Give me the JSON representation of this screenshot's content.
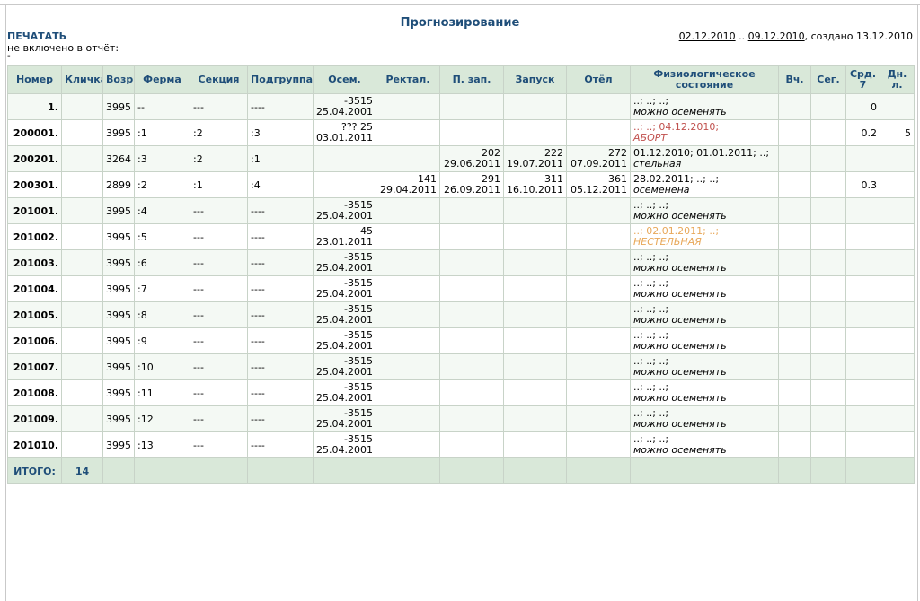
{
  "page": {
    "title": "Прогнозирование",
    "print_label": "ПЕЧАТАТЬ",
    "not_included": "не включено в отчёт:",
    "dash": "-",
    "date_from": "02.12.2010",
    "range_sep": " .. ",
    "date_to": "09.12.2010",
    "created": ", создано 13.12.2010"
  },
  "table": {
    "headers": [
      "Номер",
      "Кличка",
      "Возр.",
      "Ферма",
      "Секция",
      "Подгруппа",
      "Осем.",
      "Ректал.",
      "П. зап.",
      "Запуск",
      "Отёл",
      "Физиологическое состояние",
      "Вч.",
      "Сег.",
      "Срд. 7",
      "Дн. л."
    ],
    "rows": [
      {
        "num": "1.",
        "name": "",
        "age": "3995",
        "farm": "--",
        "section": "---",
        "subgroup": "----",
        "osem": [
          "-3515",
          "25.04.2001"
        ],
        "rekt": [
          "",
          ""
        ],
        "pzap": [
          "",
          ""
        ],
        "zapusk": [
          "",
          ""
        ],
        "otel": [
          "",
          ""
        ],
        "state": [
          "..; ..; ..;",
          "можно осеменять"
        ],
        "state_color": "",
        "vch": "",
        "seg": "",
        "srd": "0",
        "dnl": ""
      },
      {
        "num": "200001.",
        "name": "",
        "age": "3995",
        "farm": ":1",
        "section": ":2",
        "subgroup": ":3",
        "osem": [
          "??? 25",
          "03.01.2011"
        ],
        "rekt": [
          "",
          ""
        ],
        "pzap": [
          "",
          ""
        ],
        "zapusk": [
          "",
          ""
        ],
        "otel": [
          "",
          ""
        ],
        "state": [
          "..; ..; 04.12.2010;",
          "АБОРТ"
        ],
        "state_color": "red",
        "vch": "",
        "seg": "",
        "srd": "0.2",
        "dnl": "5"
      },
      {
        "num": "200201.",
        "name": "",
        "age": "3264",
        "farm": ":3",
        "section": ":2",
        "subgroup": ":1",
        "osem": [
          "",
          ""
        ],
        "rekt": [
          "",
          ""
        ],
        "pzap": [
          "202",
          "29.06.2011"
        ],
        "zapusk": [
          "222",
          "19.07.2011"
        ],
        "otel": [
          "272",
          "07.09.2011"
        ],
        "state": [
          "01.12.2010; 01.01.2011; ..;",
          "стельная"
        ],
        "state_color": "",
        "vch": "",
        "seg": "",
        "srd": "",
        "dnl": ""
      },
      {
        "num": "200301.",
        "name": "",
        "age": "2899",
        "farm": ":2",
        "section": ":1",
        "subgroup": ":4",
        "osem": [
          "",
          ""
        ],
        "rekt": [
          "141",
          "29.04.2011"
        ],
        "pzap": [
          "291",
          "26.09.2011"
        ],
        "zapusk": [
          "311",
          "16.10.2011"
        ],
        "otel": [
          "361",
          "05.12.2011"
        ],
        "state": [
          "28.02.2011; ..; ..;",
          "осеменена"
        ],
        "state_color": "",
        "vch": "",
        "seg": "",
        "srd": "0.3",
        "dnl": ""
      },
      {
        "num": "201001.",
        "name": "",
        "age": "3995",
        "farm": ":4",
        "section": "---",
        "subgroup": "----",
        "osem": [
          "-3515",
          "25.04.2001"
        ],
        "rekt": [
          "",
          ""
        ],
        "pzap": [
          "",
          ""
        ],
        "zapusk": [
          "",
          ""
        ],
        "otel": [
          "",
          ""
        ],
        "state": [
          "..; ..; ..;",
          "можно осеменять"
        ],
        "state_color": "",
        "vch": "",
        "seg": "",
        "srd": "",
        "dnl": ""
      },
      {
        "num": "201002.",
        "name": "",
        "age": "3995",
        "farm": ":5",
        "section": "---",
        "subgroup": "----",
        "osem": [
          "45",
          "23.01.2011"
        ],
        "rekt": [
          "",
          ""
        ],
        "pzap": [
          "",
          ""
        ],
        "zapusk": [
          "",
          ""
        ],
        "otel": [
          "",
          ""
        ],
        "state": [
          "..; 02.01.2011; ..;",
          "НЕСТЕЛЬНАЯ"
        ],
        "state_color": "orange",
        "vch": "",
        "seg": "",
        "srd": "",
        "dnl": ""
      },
      {
        "num": "201003.",
        "name": "",
        "age": "3995",
        "farm": ":6",
        "section": "---",
        "subgroup": "----",
        "osem": [
          "-3515",
          "25.04.2001"
        ],
        "rekt": [
          "",
          ""
        ],
        "pzap": [
          "",
          ""
        ],
        "zapusk": [
          "",
          ""
        ],
        "otel": [
          "",
          ""
        ],
        "state": [
          "..; ..; ..;",
          "можно осеменять"
        ],
        "state_color": "",
        "vch": "",
        "seg": "",
        "srd": "",
        "dnl": ""
      },
      {
        "num": "201004.",
        "name": "",
        "age": "3995",
        "farm": ":7",
        "section": "---",
        "subgroup": "----",
        "osem": [
          "-3515",
          "25.04.2001"
        ],
        "rekt": [
          "",
          ""
        ],
        "pzap": [
          "",
          ""
        ],
        "zapusk": [
          "",
          ""
        ],
        "otel": [
          "",
          ""
        ],
        "state": [
          "..; ..; ..;",
          "можно осеменять"
        ],
        "state_color": "",
        "vch": "",
        "seg": "",
        "srd": "",
        "dnl": ""
      },
      {
        "num": "201005.",
        "name": "",
        "age": "3995",
        "farm": ":8",
        "section": "---",
        "subgroup": "----",
        "osem": [
          "-3515",
          "25.04.2001"
        ],
        "rekt": [
          "",
          ""
        ],
        "pzap": [
          "",
          ""
        ],
        "zapusk": [
          "",
          ""
        ],
        "otel": [
          "",
          ""
        ],
        "state": [
          "..; ..; ..;",
          "можно осеменять"
        ],
        "state_color": "",
        "vch": "",
        "seg": "",
        "srd": "",
        "dnl": ""
      },
      {
        "num": "201006.",
        "name": "",
        "age": "3995",
        "farm": ":9",
        "section": "---",
        "subgroup": "----",
        "osem": [
          "-3515",
          "25.04.2001"
        ],
        "rekt": [
          "",
          ""
        ],
        "pzap": [
          "",
          ""
        ],
        "zapusk": [
          "",
          ""
        ],
        "otel": [
          "",
          ""
        ],
        "state": [
          "..; ..; ..;",
          "можно осеменять"
        ],
        "state_color": "",
        "vch": "",
        "seg": "",
        "srd": "",
        "dnl": ""
      },
      {
        "num": "201007.",
        "name": "",
        "age": "3995",
        "farm": ":10",
        "section": "---",
        "subgroup": "----",
        "osem": [
          "-3515",
          "25.04.2001"
        ],
        "rekt": [
          "",
          ""
        ],
        "pzap": [
          "",
          ""
        ],
        "zapusk": [
          "",
          ""
        ],
        "otel": [
          "",
          ""
        ],
        "state": [
          "..; ..; ..;",
          "можно осеменять"
        ],
        "state_color": "",
        "vch": "",
        "seg": "",
        "srd": "",
        "dnl": ""
      },
      {
        "num": "201008.",
        "name": "",
        "age": "3995",
        "farm": ":11",
        "section": "---",
        "subgroup": "----",
        "osem": [
          "-3515",
          "25.04.2001"
        ],
        "rekt": [
          "",
          ""
        ],
        "pzap": [
          "",
          ""
        ],
        "zapusk": [
          "",
          ""
        ],
        "otel": [
          "",
          ""
        ],
        "state": [
          "..; ..; ..;",
          "можно осеменять"
        ],
        "state_color": "",
        "vch": "",
        "seg": "",
        "srd": "",
        "dnl": ""
      },
      {
        "num": "201009.",
        "name": "",
        "age": "3995",
        "farm": ":12",
        "section": "---",
        "subgroup": "----",
        "osem": [
          "-3515",
          "25.04.2001"
        ],
        "rekt": [
          "",
          ""
        ],
        "pzap": [
          "",
          ""
        ],
        "zapusk": [
          "",
          ""
        ],
        "otel": [
          "",
          ""
        ],
        "state": [
          "..; ..; ..;",
          "можно осеменять"
        ],
        "state_color": "",
        "vch": "",
        "seg": "",
        "srd": "",
        "dnl": ""
      },
      {
        "num": "201010.",
        "name": "",
        "age": "3995",
        "farm": ":13",
        "section": "---",
        "subgroup": "----",
        "osem": [
          "-3515",
          "25.04.2001"
        ],
        "rekt": [
          "",
          ""
        ],
        "pzap": [
          "",
          ""
        ],
        "zapusk": [
          "",
          ""
        ],
        "otel": [
          "",
          ""
        ],
        "state": [
          "..; ..; ..;",
          "можно осеменять"
        ],
        "state_color": "",
        "vch": "",
        "seg": "",
        "srd": "",
        "dnl": ""
      }
    ],
    "total": {
      "label": "ИТОГО:",
      "count": "14"
    }
  }
}
